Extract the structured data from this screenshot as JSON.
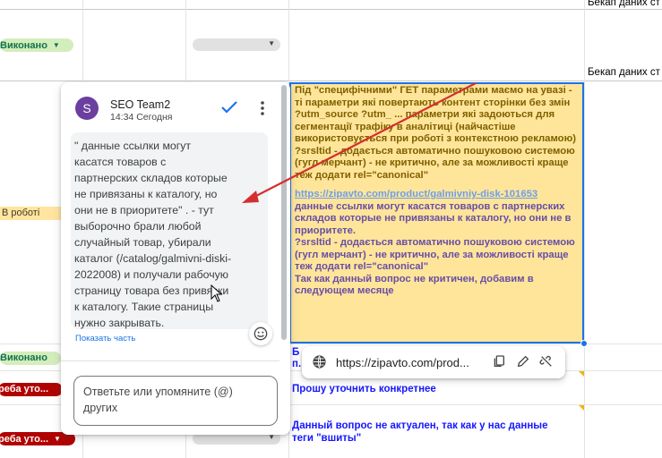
{
  "sheet": {
    "top_right_cells": [
      "Бекап даних ст",
      "Бекап даних ст"
    ],
    "status_chips": {
      "done_1": "Виконано",
      "in_progress": "В роботі",
      "done_2": "Виконано",
      "needs_clarify_1": "реба уто...",
      "needs_clarify_2": "реба уто..."
    },
    "note_cell": {
      "para1": "Під \"специфічними\" ГЕТ параметрами маємо на увазі - ті параметри які повертають контент сторінки без змін",
      "para2": "?utm_source ?utm_ ... параметри які задоються для сегментації трафіку в аналітиці (найчастіше використовується при роботі з контекстною рекламою)",
      "para3": "?srsltid - додається автоматично пошуковою системою (гугл мерчант) - не критично, але за можливості краще теж додати  rel=\"canonical\"",
      "link": "https://zipavto.com/product/galmivniy-disk-101653",
      "para4": "данные ссылки могут касатся товаров с партнерских складов которые не привязаны к каталогу, но они не в приоритете.",
      "para5": "?srsltid - додається автоматично пошуковою системою (гугл мерчант) - не критично, але за можливості краще теж додати  rel=\"canonical\"",
      "para6": "Так как данный вопрос не критичен, добавим в следующем месяце"
    },
    "partial_cell_text": [
      "Б",
      "п."
    ],
    "clarify_text": "Прошу уточнить конкретнее",
    "not_relevant_text_1": "Данный вопрос не актуален, так как у нас данные",
    "not_relevant_text_2": "теги \"вшиты\""
  },
  "link_popup": {
    "url": "https://zipavto.com/prod...",
    "icons": [
      "globe-icon",
      "copy-icon",
      "edit-icon",
      "unlink-icon"
    ]
  },
  "comment": {
    "avatar_letter": "S",
    "author": "SEO Team2",
    "time": "14:34 Сегодня",
    "quote_lines": [
      "\" данные ссылки могут",
      "касатся товаров с",
      "партнерских складов которые",
      "не привязаны к каталогу, но",
      "они не в приоритете\" .  -  тут",
      "выборочно брали любой",
      "случайный товар, убирали",
      "каталог (/catalog/galmivni-diski-",
      "2022008) и получали рабочую",
      "страницу товара без привязки",
      "к каталогу. Такие страницы",
      "нужно закрывать."
    ],
    "show_part": "Показать часть",
    "reply_placeholder": "Ответьте или упомяните (@) других"
  },
  "colors": {
    "accent": "#1a73e8",
    "note_bg": "#ffe599",
    "annotation_arrow": "#d32f2f",
    "avatar": "#6b3fa0"
  }
}
